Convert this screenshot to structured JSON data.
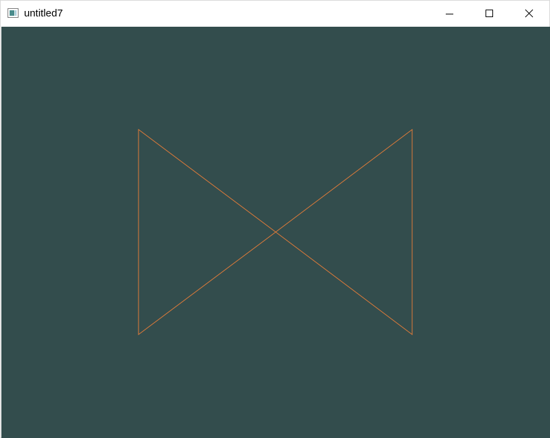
{
  "window": {
    "title": "untitled7",
    "controls": {
      "minimize": "minimize-icon",
      "maximize": "maximize-icon",
      "close": "close-icon"
    }
  },
  "canvas": {
    "background_color": "#334d4d",
    "stroke_color": "#e07b39",
    "shape": "bowtie"
  }
}
